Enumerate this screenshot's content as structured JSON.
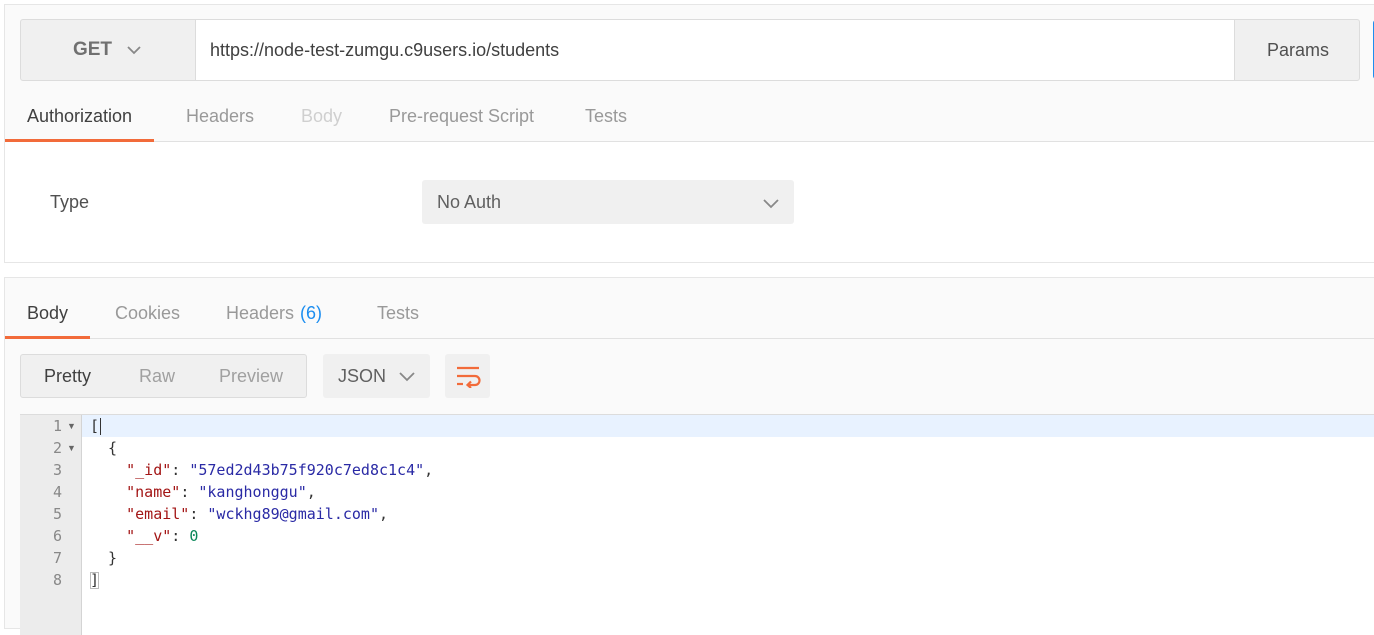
{
  "request": {
    "method": "GET",
    "url": "https://node-test-zumgu.c9users.io/students",
    "params_label": "Params",
    "tabs": [
      {
        "label": "Authorization",
        "state": "active"
      },
      {
        "label": "Headers",
        "state": "normal"
      },
      {
        "label": "Body",
        "state": "disabled"
      },
      {
        "label": "Pre-request Script",
        "state": "normal"
      },
      {
        "label": "Tests",
        "state": "normal"
      }
    ],
    "auth": {
      "type_label": "Type",
      "type_value": "No Auth"
    }
  },
  "response": {
    "tabs": [
      {
        "label": "Body",
        "state": "active"
      },
      {
        "label": "Cookies",
        "state": "normal"
      },
      {
        "label": "Headers",
        "count": "(6)",
        "state": "normal"
      },
      {
        "label": "Tests",
        "state": "normal"
      }
    ],
    "view_modes": [
      "Pretty",
      "Raw",
      "Preview"
    ],
    "active_view_mode": "Pretty",
    "format": "JSON",
    "code_lines": [
      {
        "num": "1",
        "fold": true,
        "text": "["
      },
      {
        "num": "2",
        "fold": true,
        "text": "  {"
      },
      {
        "num": "3",
        "fold": false,
        "key": "\"_id\"",
        "value": "\"57ed2d43b75f920c7ed8c1c4\"",
        "value_type": "string",
        "trail": ","
      },
      {
        "num": "4",
        "fold": false,
        "key": "\"name\"",
        "value": "\"kanghonggu\"",
        "value_type": "string",
        "trail": ","
      },
      {
        "num": "5",
        "fold": false,
        "key": "\"email\"",
        "value": "\"wckhg89@gmail.com\"",
        "value_type": "string",
        "trail": ","
      },
      {
        "num": "6",
        "fold": false,
        "key": "\"__v\"",
        "value": "0",
        "value_type": "number",
        "trail": ""
      },
      {
        "num": "7",
        "fold": false,
        "text": "  }"
      },
      {
        "num": "8",
        "fold": false,
        "text": "]"
      }
    ]
  },
  "colors": {
    "accent": "#f26b3a",
    "link": "#1c8ef0"
  },
  "icons": {
    "method_dropdown": "chevron-down-icon",
    "format_dropdown": "chevron-down-icon",
    "wrap": "wrap-lines-icon"
  }
}
